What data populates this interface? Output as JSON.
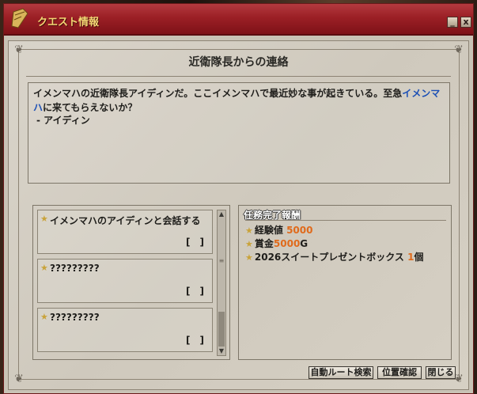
{
  "window": {
    "title": "クエスト情報",
    "minimize_label": "_",
    "close_label": "x"
  },
  "quest": {
    "title": "近衛隊長からの連絡",
    "description_part1": "イメンマハの近衛隊長アイディンだ。ここイメンマハで最近妙な事が起きている。至急",
    "description_link": "イメンマハ",
    "description_part2": "に来てもらえないか？",
    "signature": "- アイディン"
  },
  "objectives": [
    {
      "text": "イメンマハのアイディンと会話する",
      "progress": "[　]"
    },
    {
      "text": "?????????",
      "progress": "[　]"
    },
    {
      "text": "?????????",
      "progress": "[　]"
    }
  ],
  "rewards": {
    "header": "任務完了報酬",
    "items": [
      {
        "label": "経験値",
        "value": "5000",
        "suffix": ""
      },
      {
        "label": "賞金",
        "value": "5000",
        "suffix": "G"
      },
      {
        "label": "2026スイートプレゼントボックス",
        "value": "1",
        "suffix": "個"
      }
    ]
  },
  "buttons": {
    "auto_route": "自動ルート検索",
    "location": "位置確認",
    "close": "閉じる"
  },
  "colors": {
    "titlebar": "#9b1f25",
    "title_text": "#f3d774",
    "link": "#1b4fb5",
    "reward_value": "#e06a1b"
  }
}
